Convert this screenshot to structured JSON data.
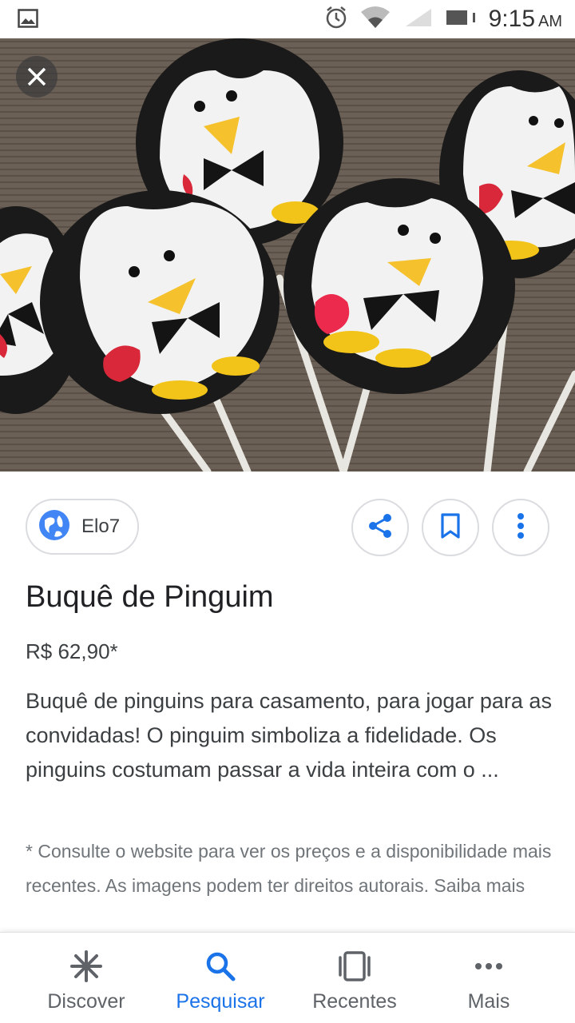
{
  "status_bar": {
    "time": "9:15",
    "ampm": "AM",
    "icons": [
      "image-icon",
      "alarm-icon",
      "wifi-icon",
      "battery-icon"
    ]
  },
  "hero": {
    "image_description": "felt penguins on sticks",
    "close_icon": "close-icon"
  },
  "source": {
    "name": "Elo7",
    "icon": "globe-icon",
    "accent": "#4285f4"
  },
  "actions": [
    {
      "name": "share",
      "icon": "share-icon"
    },
    {
      "name": "save",
      "icon": "bookmark-icon"
    },
    {
      "name": "more",
      "icon": "more-vert-icon"
    }
  ],
  "product": {
    "title": "Buquê de Pinguim",
    "price": "R$ 62,90*",
    "description": "Buquê de pinguins para casamento, para jogar para as convidadas! O pinguim simboliza a fidelidade. Os pinguins costumam passar a vida inteira com o ...",
    "disclaimer": "* Consulte o website para ver os preços e a disponibilidade mais recentes. As imagens podem ter direitos autorais. Saiba mais"
  },
  "bottom_nav": {
    "active_color": "#1a73e8",
    "items": [
      {
        "label": "Discover",
        "icon": "asterisk-icon"
      },
      {
        "label": "Pesquisar",
        "icon": "search-icon"
      },
      {
        "label": "Recentes",
        "icon": "recents-icon"
      },
      {
        "label": "Mais",
        "icon": "more-horiz-icon"
      }
    ]
  }
}
